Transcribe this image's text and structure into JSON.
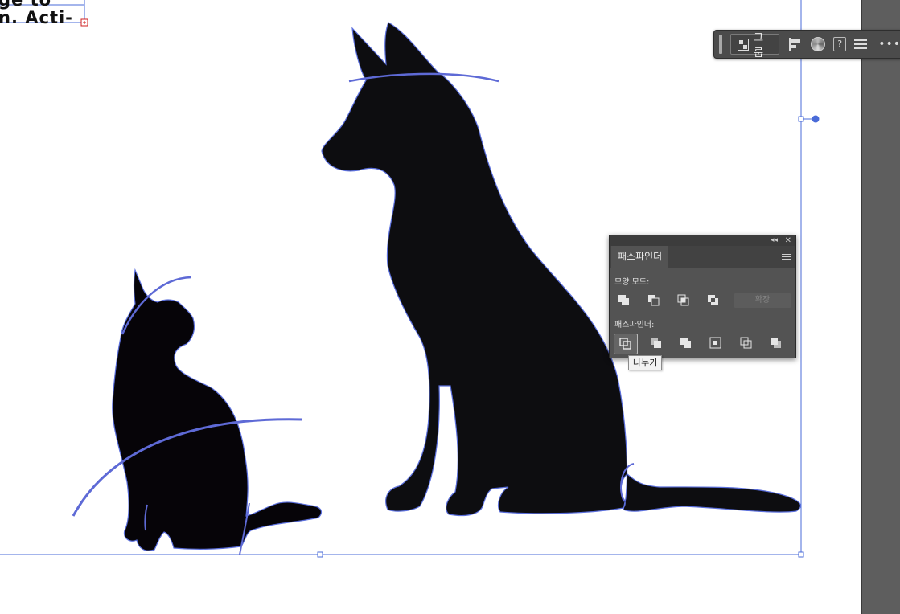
{
  "canvas": {
    "top_text_line1": "ge   to",
    "top_text_line2": "n.  Acti-",
    "accent_color": "#4a6bd8",
    "silhouette_color": "#0d0d10"
  },
  "control_bar": {
    "group_label": "그룹",
    "icons": [
      "grip-icon",
      "group-icon",
      "align-icon",
      "recolor-icon",
      "help-icon",
      "menu-icon",
      "more-icon"
    ],
    "help_glyph": "?",
    "more_glyph": "•••"
  },
  "pathfinder_panel": {
    "collapse_glyph": "◂◂",
    "close_glyph": "✕",
    "tab_title": "패스파인더",
    "shape_modes_label": "모양 모드:",
    "expand_label": "확장",
    "pathfinders_label": "패스파인더:",
    "tooltip": "나누기"
  }
}
